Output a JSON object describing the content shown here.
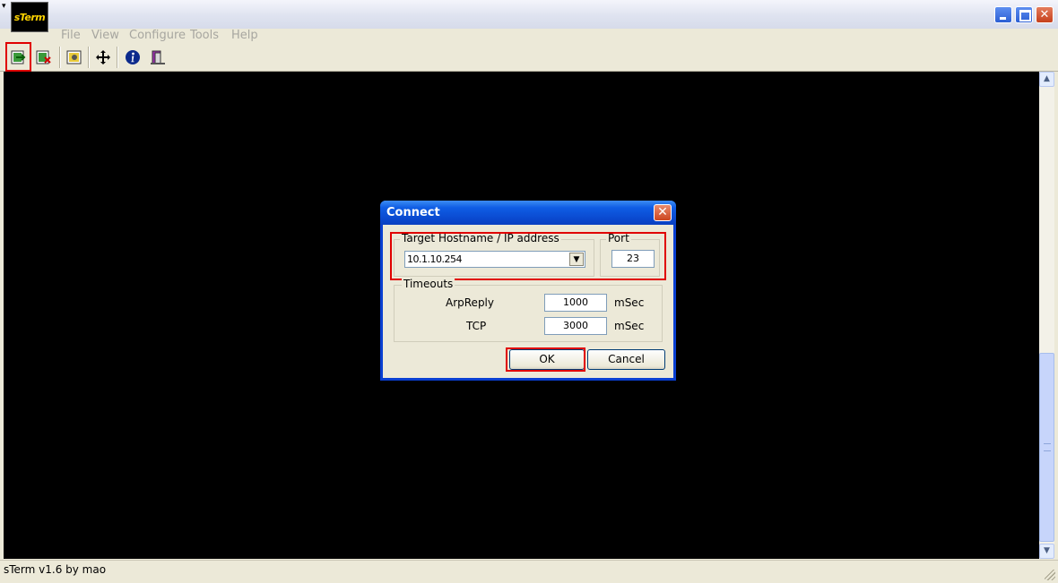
{
  "window": {
    "logo_text": "sTerm"
  },
  "menu": [
    {
      "label": "File",
      "hot": "F"
    },
    {
      "label": "View",
      "hot": "V"
    },
    {
      "label": "Configure",
      "hot": "C"
    },
    {
      "label": "Tools",
      "hot": "T"
    },
    {
      "label": "Help",
      "hot": "H"
    }
  ],
  "toolbar": {
    "icons": [
      "connect-icon",
      "disconnect-icon",
      "settings-icon",
      "move-icon",
      "info-icon",
      "exit-icon"
    ]
  },
  "statusbar": {
    "text": "sTerm v1.6 by mao"
  },
  "dialog": {
    "title": "Connect",
    "close_label": "✕",
    "host_group": "Target Hostname / IP address",
    "host_value": "10.1.10.254",
    "port_group": "Port",
    "port_value": "23",
    "timeouts_group": "Timeouts",
    "arp_label": "ArpReply",
    "arp_value": "1000",
    "tcp_label": "TCP",
    "tcp_value": "3000",
    "unit_label": "mSec",
    "ok_label": "OK",
    "cancel_label": "Cancel"
  },
  "colors": {
    "highlight": "#e00000",
    "terminal_bg": "#000000",
    "dialog_titlebar": "#0a49cf"
  }
}
